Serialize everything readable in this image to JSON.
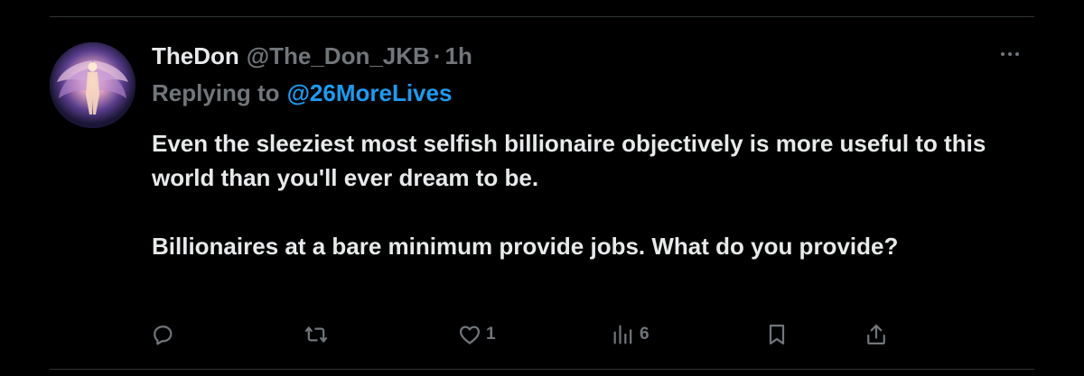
{
  "tweet": {
    "display_name": "TheDon",
    "handle": "@The_Don_JKB",
    "separator": "·",
    "time": "1h",
    "replying_prefix": "Replying to",
    "replying_to": "@26MoreLives",
    "text_paragraphs": [
      "Even the sleeziest most selfish billionaire objectively is more useful to this world than you'll ever dream to be.",
      "Billionaires at a bare minimum provide jobs.  What do you provide?"
    ]
  },
  "actions": {
    "reply_count": "",
    "retweet_count": "",
    "like_count": "1",
    "views_count": "6"
  },
  "icons": {
    "reply": "reply-icon",
    "retweet": "retweet-icon",
    "like": "heart-icon",
    "views": "views-chart-icon",
    "bookmark": "bookmark-icon",
    "share": "share-icon",
    "more": "more-dots-icon"
  },
  "colors": {
    "background": "#000000",
    "text": "#e7e9ea",
    "secondary": "#71767b",
    "link": "#1d9bf0",
    "divider": "#2f3336"
  }
}
